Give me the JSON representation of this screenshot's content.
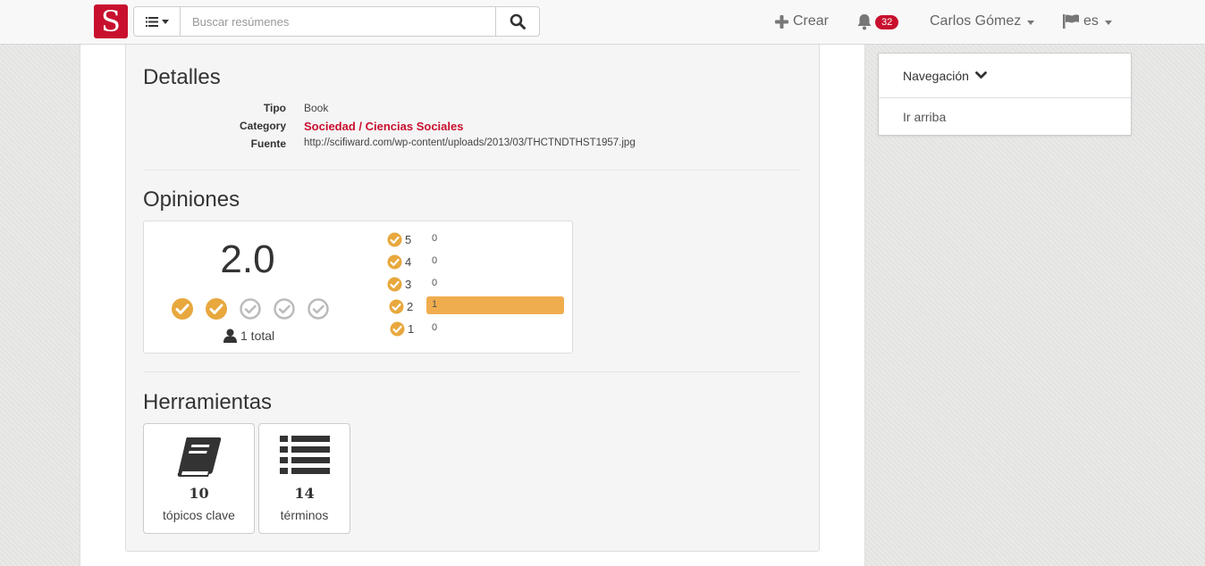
{
  "navbar": {
    "logo_letter": "S",
    "search_placeholder": "Buscar resúmenes",
    "create_label": "Crear",
    "notifications_count": "32",
    "user_name": "Carlos Gómez",
    "language": "es"
  },
  "details": {
    "heading": "Detalles",
    "rows": [
      {
        "term": "Tipo",
        "value": "Book"
      },
      {
        "term": "Category",
        "value": "Sociedad / Ciencias Sociales"
      },
      {
        "term": "Fuente",
        "value": "http://scifiward.com/wp-content/uploads/2013/03/THCTNDTHST1957.jpg"
      }
    ]
  },
  "opinions": {
    "heading": "Opiniones",
    "average": "2.0",
    "stars_filled": 2,
    "stars_total": 5,
    "total_label": "1 total",
    "distribution": [
      {
        "stars": "5",
        "count": "0",
        "fraction": 0
      },
      {
        "stars": "4",
        "count": "0",
        "fraction": 0
      },
      {
        "stars": "3",
        "count": "0",
        "fraction": 0
      },
      {
        "stars": "2",
        "count": "1",
        "fraction": 1
      },
      {
        "stars": "1",
        "count": "0",
        "fraction": 0
      }
    ]
  },
  "tools": {
    "heading": "Herramientas",
    "items": [
      {
        "icon": "book-icon",
        "count": "10",
        "label": "tópicos clave"
      },
      {
        "icon": "list-icon",
        "count": "14",
        "label": "términos"
      }
    ]
  },
  "sidebar": {
    "nav_title": "Navegación",
    "top_link": "Ir arriba"
  },
  "colors": {
    "brand": "#c8102e",
    "star": "#e8a83e",
    "star_empty": "#bbbbbb",
    "bar": "#f0ad4e"
  }
}
